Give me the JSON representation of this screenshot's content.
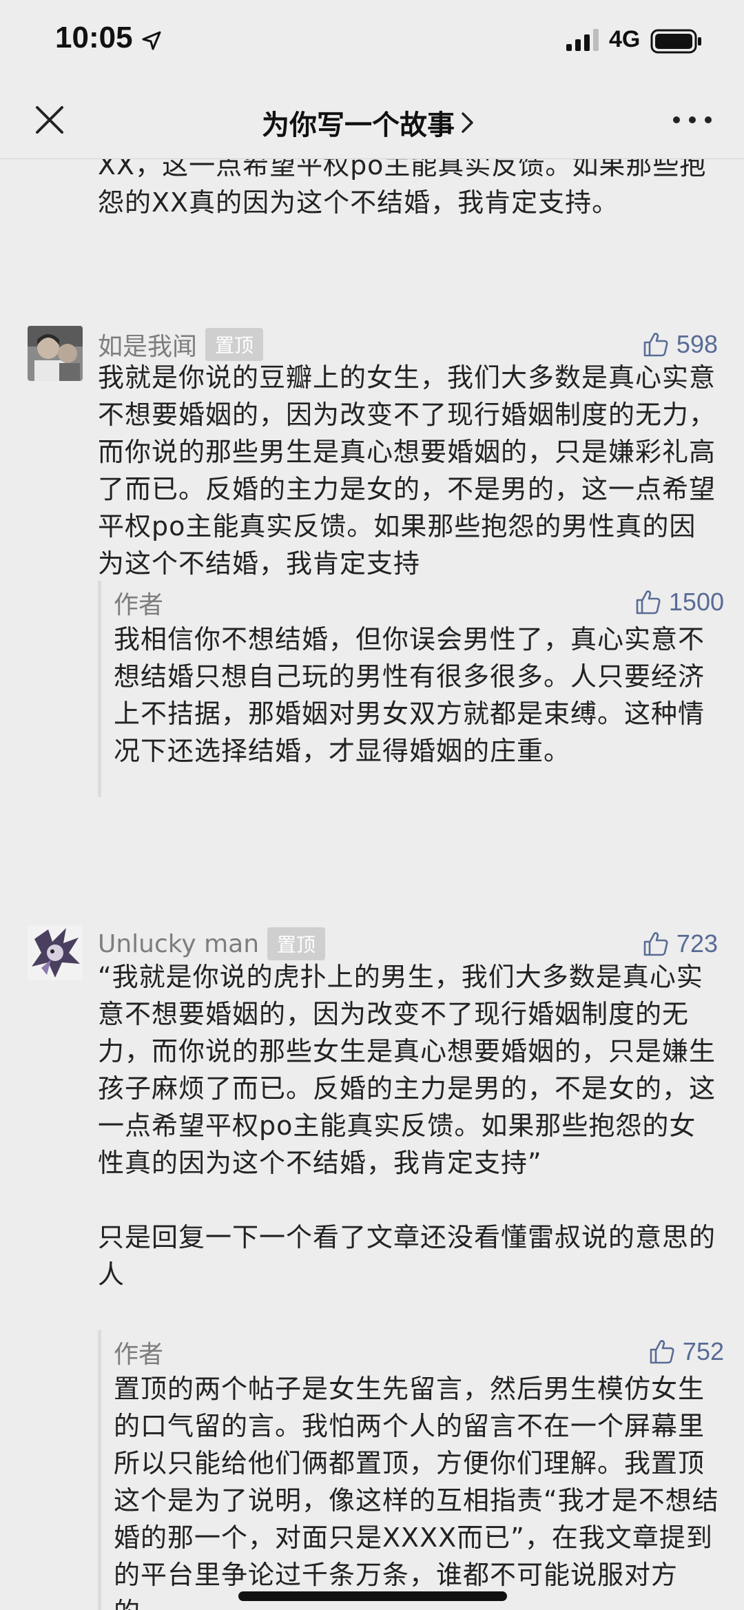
{
  "status_bar": {
    "time": "10:05",
    "network": "4G"
  },
  "nav": {
    "title": "为你写一个故事"
  },
  "top_fragment": {
    "text": "XX，这一点希望平权po主能真实反馈。如果那些抱怨的XX真的因为这个不结婚，我肯定支持。"
  },
  "comments": [
    {
      "name": "如是我闻",
      "badge": "置顶",
      "likes": "598",
      "text": "我就是你说的豆瓣上的女生，我们大多数是真心实意不想要婚姻的，因为改变不了现行婚姻制度的无力，而你说的那些男生是真心想要婚姻的，只是嫌彩礼高了而已。反婚的主力是女的，不是男的，这一点希望平权po主能真实反馈。如果那些抱怨的男性真的因为这个不结婚，我肯定支持",
      "reply": {
        "author": "作者",
        "likes": "1500",
        "text": "我相信你不想结婚，但你误会男性了，真心实意不想结婚只想自己玩的男性有很多很多。人只要经济上不拮据，那婚姻对男女双方就都是束缚。这种情况下还选择结婚，才显得婚姻的庄重。"
      }
    },
    {
      "name": "Unlucky man",
      "badge": "置顶",
      "likes": "723",
      "text": "“我就是你说的虎扑上的男生，我们大多数是真心实意不想要婚姻的，因为改变不了现行婚姻制度的无力，而你说的那些女生是真心想要婚姻的，只是嫌生孩子麻烦了而已。反婚的主力是男的，不是女的，这一点希望平权po主能真实反馈。如果那些抱怨的女性真的因为这个不结婚，我肯定支持”",
      "text2": "只是回复一下一个看了文章还没看懂雷叔说的意思的人",
      "reply": {
        "author": "作者",
        "likes": "752",
        "text": "置顶的两个帖子是女生先留言，然后男生模仿女生的口气留的言。我怕两个人的留言不在一个屏幕里所以只能给他们俩都置顶，方便你们理解。我置顶这个是为了说明，像这样的互相指责“我才是不想结婚的那一个，对面只是XXXX而已”，在我文章提到的平台里争论过千条万条，谁都不可能说服对方的。"
      }
    }
  ]
}
